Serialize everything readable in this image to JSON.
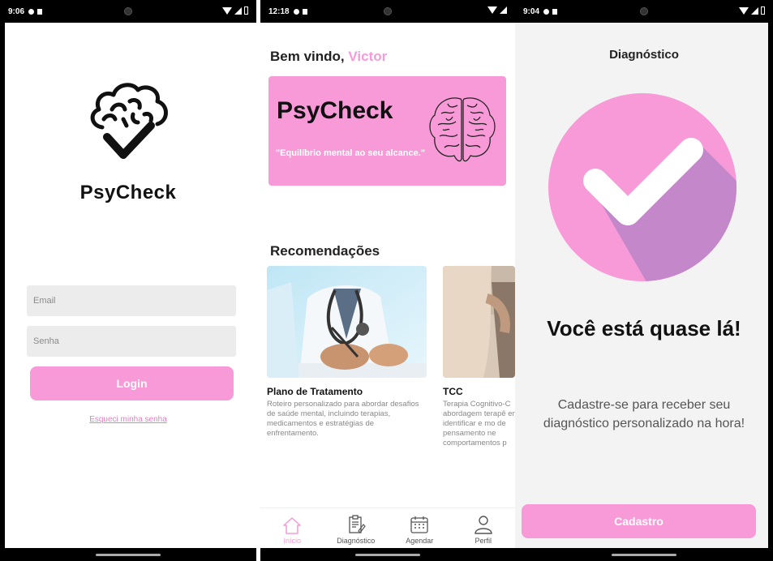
{
  "colors": {
    "accent": "#f79ad7",
    "accent_dark": "#c487c9"
  },
  "screen_login": {
    "status_time": "9:06",
    "brand": "PsyCheck",
    "email_placeholder": "Email",
    "password_placeholder": "Senha",
    "login_label": "Login",
    "forgot_label": "Esqueci minha senha"
  },
  "screen_home": {
    "status_time": "12:18",
    "welcome_prefix": "Bem vindo,",
    "user_name": "Victor",
    "banner_title": "PsyCheck",
    "banner_quote": "\"Equilíbrio mental ao seu alcance.\"",
    "recommendations_title": "Recomendações",
    "cards": [
      {
        "title": "Plano de Tratamento",
        "description": "Roteiro personalizado para abordar desafios de saúde mental, incluindo terapias, medicamentos e estratégias de enfrentamento."
      },
      {
        "title": "TCC",
        "description": "Terapia Cognitivo-C abordagem terapê em identificar e mo de pensamento ne comportamentos p"
      }
    ],
    "nav": [
      {
        "label": "Início",
        "icon": "home-icon",
        "active": true
      },
      {
        "label": "Diagnóstico",
        "icon": "clipboard-icon",
        "active": false
      },
      {
        "label": "Agendar",
        "icon": "calendar-icon",
        "active": false
      },
      {
        "label": "Perfil",
        "icon": "user-icon",
        "active": false
      }
    ]
  },
  "screen_diagnosis": {
    "status_time": "9:04",
    "title": "Diagnóstico",
    "headline": "Você está quase lá!",
    "subtitle": "Cadastre-se para receber seu diagnóstico personalizado na hora!",
    "cadastro_label": "Cadastro"
  }
}
